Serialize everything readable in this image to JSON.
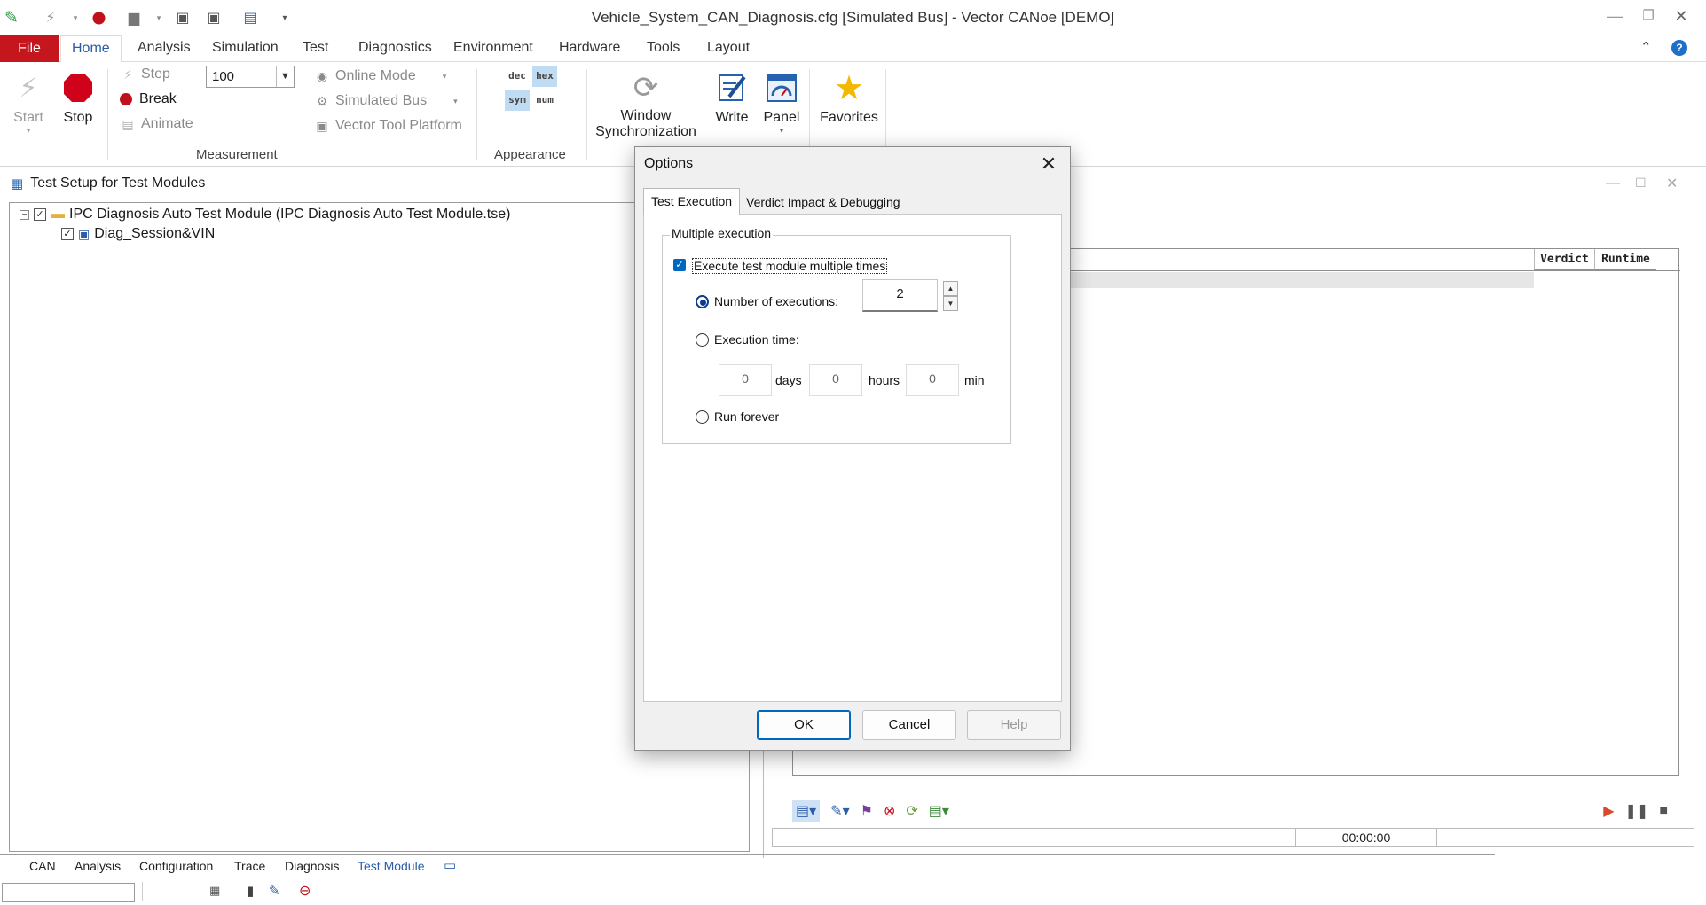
{
  "window": {
    "title": "Vehicle_System_CAN_Diagnosis.cfg [Simulated Bus] - Vector CANoe [DEMO]"
  },
  "ribbon_tabs": [
    "File",
    "Home",
    "Analysis",
    "Simulation",
    "Test",
    "Diagnostics",
    "Environment",
    "Hardware",
    "Tools",
    "Layout"
  ],
  "ribbon": {
    "start": "Start",
    "stop": "Stop",
    "step": "Step",
    "break": "Break",
    "animate": "Animate",
    "speed_value": "100",
    "online_mode": "Online Mode",
    "simulated_bus": "Simulated Bus",
    "vector_tool_platform": "Vector Tool Platform",
    "measurement_group": "Measurement",
    "fmt_dec": "dec",
    "fmt_hex": "hex",
    "fmt_sym": "sym",
    "fmt_num": "num",
    "appearance_group": "Appearance",
    "window_sync_1": "Window",
    "window_sync_2": "Synchronization",
    "write": "Write",
    "panel": "Panel",
    "favorites": "Favorites"
  },
  "test_setup": {
    "title": "Test Setup for Test Modules",
    "module": "IPC Diagnosis Auto Test Module  (IPC Diagnosis Auto Test Module.tse)",
    "child": "Diag_Session&VIN"
  },
  "right_panel": {
    "col_verdict": "Verdict",
    "col_runtime": "Runtime",
    "elapsed": "00:00:00"
  },
  "bottom_tabs": [
    "CAN",
    "Analysis",
    "Configuration",
    "Trace",
    "Diagnosis",
    "Test Module"
  ],
  "dialog": {
    "title": "Options",
    "tab_test_execution": "Test Execution",
    "tab_verdict_impact": "Verdict Impact & Debugging",
    "group_label": "Multiple execution",
    "execute_multiple": "Execute test module multiple times",
    "num_exec_label": "Number of executions:",
    "num_exec_value": "2",
    "exec_time_label": "Execution time:",
    "days_value": "0",
    "days_label": "days",
    "hours_value": "0",
    "hours_label": "hours",
    "min_value": "0",
    "min_label": "min",
    "run_forever": "Run forever",
    "ok": "OK",
    "cancel": "Cancel",
    "help": "Help"
  },
  "colors": {
    "file_tab": "#c4161c",
    "accent": "#0067c0",
    "active_tab_text": "#2b5ea8",
    "stop_red": "#d0021b"
  }
}
